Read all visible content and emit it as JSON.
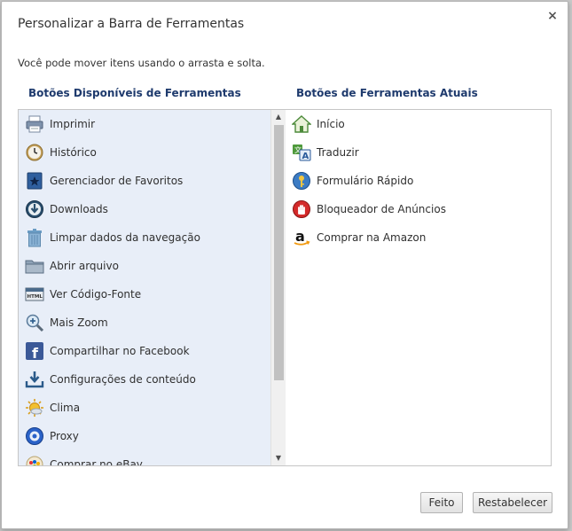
{
  "dialog": {
    "title": "Personalizar a Barra de Ferramentas",
    "close_glyph": "×",
    "subtitle": "Você pode mover itens usando o arrasta e solta."
  },
  "available": {
    "heading": "Botões Disponíveis de Ferramentas",
    "items": [
      {
        "label": "Imprimir",
        "icon": "printer-icon"
      },
      {
        "label": "Histórico",
        "icon": "history-clock-icon"
      },
      {
        "label": "Gerenciador de Favoritos",
        "icon": "bookmark-star-icon"
      },
      {
        "label": "Downloads",
        "icon": "download-arrow-icon"
      },
      {
        "label": "Limpar dados da navegação",
        "icon": "trash-icon"
      },
      {
        "label": "Abrir arquivo",
        "icon": "folder-icon"
      },
      {
        "label": "Ver Código-Fonte",
        "icon": "html-source-icon"
      },
      {
        "label": "Mais Zoom",
        "icon": "zoom-in-icon"
      },
      {
        "label": "Compartilhar no Facebook",
        "icon": "facebook-icon"
      },
      {
        "label": "Configurações de conteúdo",
        "icon": "content-settings-icon"
      },
      {
        "label": "Clima",
        "icon": "weather-sun-icon"
      },
      {
        "label": "Proxy",
        "icon": "proxy-icon"
      },
      {
        "label": "Comprar no eBay",
        "icon": "ebay-icon"
      }
    ]
  },
  "current": {
    "heading": "Botões de Ferramentas Atuais",
    "items": [
      {
        "label": "Início",
        "icon": "home-icon"
      },
      {
        "label": "Traduzir",
        "icon": "translate-icon"
      },
      {
        "label": "Formulário Rápido",
        "icon": "quick-form-key-icon"
      },
      {
        "label": "Bloqueador de Anúncios",
        "icon": "ad-blocker-hand-icon"
      },
      {
        "label": "Comprar na Amazon",
        "icon": "amazon-icon"
      }
    ]
  },
  "buttons": {
    "done": "Feito",
    "reset": "Restabelecer"
  }
}
